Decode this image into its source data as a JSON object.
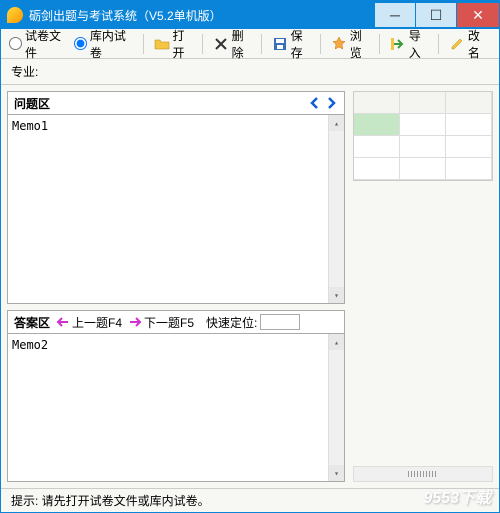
{
  "titlebar": {
    "title": "砺剑出题与考试系统（V5.2单机版）"
  },
  "toolbar": {
    "radio_paper_file": "试卷文件",
    "radio_lib_paper": "库内试卷",
    "open": "打开",
    "delete": "删除",
    "save": "保存",
    "browse": "浏览",
    "import": "导入",
    "rename": "改名"
  },
  "subbar": {
    "major_label": "专业:"
  },
  "question": {
    "header": "问题区",
    "memo": "Memo1"
  },
  "answer": {
    "header": "答案区",
    "prev": "上一题F4",
    "next": "下一题F5",
    "quick_locate_label": "快速定位:",
    "memo": "Memo2"
  },
  "statusbar": {
    "hint": "提示: 请先打开试卷文件或库内试卷。"
  },
  "watermark": "9553下载"
}
